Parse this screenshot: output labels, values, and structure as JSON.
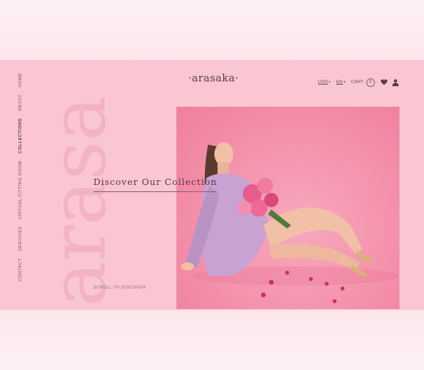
{
  "brand": {
    "logo": "·arasaka·",
    "watermark": "arasa"
  },
  "side_nav": {
    "items": [
      "CONTACT",
      "SERVICES",
      "VIRTUAL FITTING ROOM",
      "COLLECTIONS",
      "ABOUT",
      "HOME"
    ]
  },
  "top_nav": {
    "currency": "USD",
    "language": "EN",
    "cart_label": "CART",
    "cart_count": "0"
  },
  "hero": {
    "title": "Discover Our Collection",
    "scroll_label": "SCROLL TO DISCOVER"
  },
  "colors": {
    "panel": "#f9c6d2",
    "accent": "#5a3a44",
    "photo_bg": "#f38fa9"
  },
  "icons": [
    "heart-icon",
    "user-icon",
    "caret-down-icon"
  ]
}
